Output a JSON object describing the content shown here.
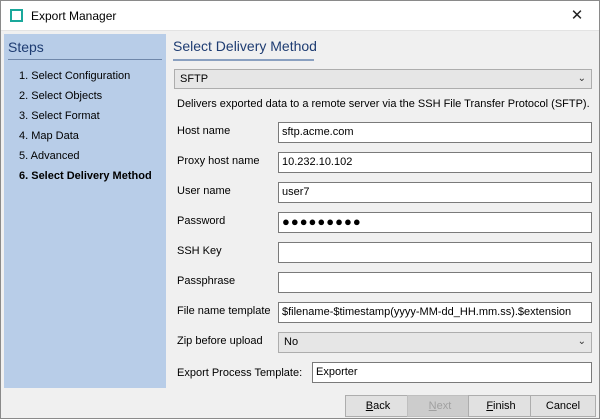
{
  "window": {
    "title": "Export Manager",
    "close_glyph": "✕"
  },
  "sidebar": {
    "title": "Steps",
    "steps": [
      {
        "label": "1. Select Configuration",
        "active": false
      },
      {
        "label": "2. Select Objects",
        "active": false
      },
      {
        "label": "3. Select Format",
        "active": false
      },
      {
        "label": "4. Map Data",
        "active": false
      },
      {
        "label": "5. Advanced",
        "active": false
      },
      {
        "label": "6. Select Delivery Method",
        "active": true
      }
    ]
  },
  "main": {
    "title": "Select Delivery Method",
    "method_select": "SFTP",
    "description": "Delivers exported data to a remote server via the SSH File Transfer Protocol (SFTP).",
    "fields": {
      "host_name": {
        "label": "Host name",
        "value": "sftp.acme.com"
      },
      "proxy_host_name": {
        "label": "Proxy host name",
        "value": "10.232.10.102"
      },
      "user_name": {
        "label": "User name",
        "value": "user7"
      },
      "password": {
        "label": "Password",
        "value": "●●●●●●●●●"
      },
      "ssh_key": {
        "label": "SSH Key",
        "value": ""
      },
      "passphrase": {
        "label": "Passphrase",
        "value": ""
      },
      "file_name_template": {
        "label": "File name template",
        "value": "$filename-$timestamp(yyyy-MM-dd_HH.mm.ss).$extension"
      }
    },
    "zip_before_upload": {
      "label": "Zip before upload",
      "value": "No"
    },
    "export_process_template": {
      "label": "Export Process Template:",
      "value": "Exporter"
    }
  },
  "footer": {
    "back": {
      "first": "B",
      "rest": "ack"
    },
    "next": {
      "first": "N",
      "rest": "ext"
    },
    "finish": {
      "first": "F",
      "rest": "inish"
    },
    "cancel": "Cancel"
  },
  "colors": {
    "sidebar_bg": "#b8cde8",
    "heading": "#1e3c72",
    "icon_accent": "#1aa89b"
  }
}
